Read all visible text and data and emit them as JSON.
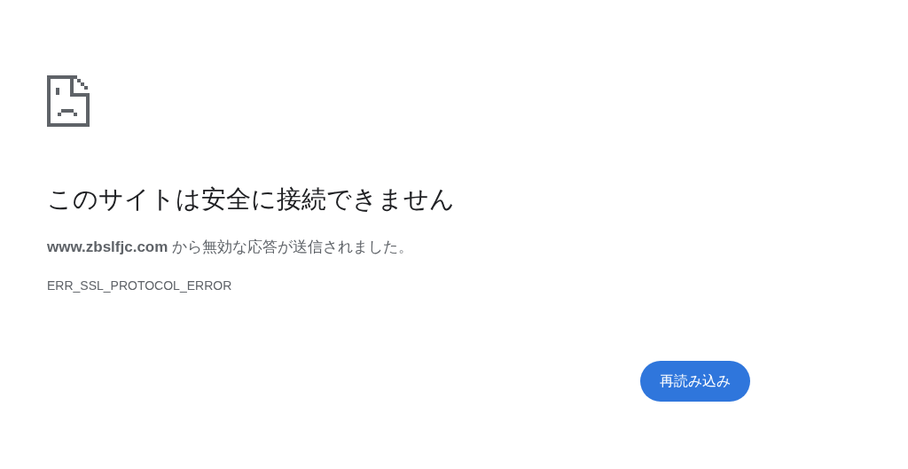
{
  "heading": "このサイトは安全に接続できません",
  "message": "**www.zbslfjc.com** から無効な応答が送信されました。",
  "error_code": "ERR_SSL_PROTOCOL_ERROR",
  "buttons": [
    "再読み込み"
  ]
}
